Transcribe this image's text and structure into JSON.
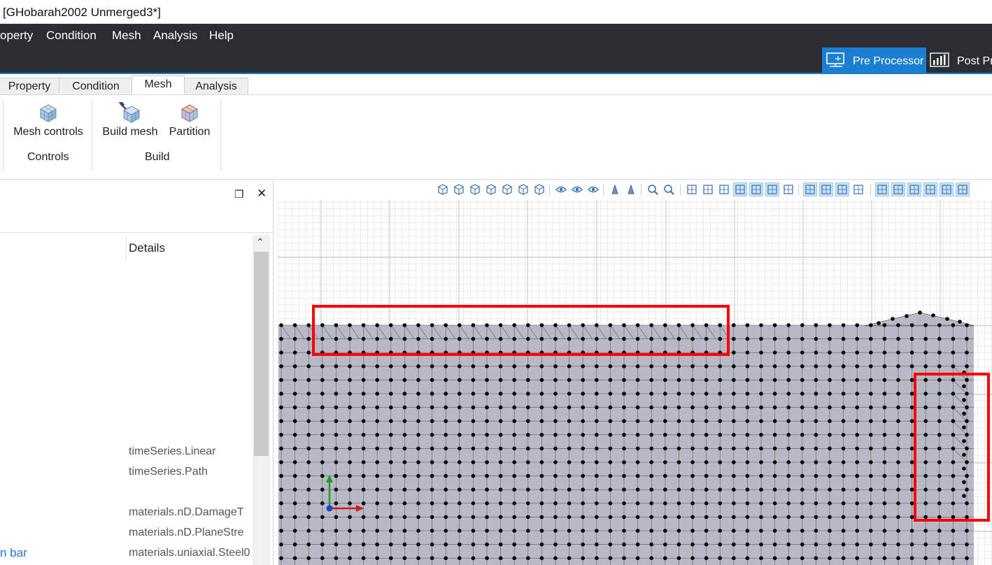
{
  "window": {
    "title": "[GHobarah2002 Unmerged3*]"
  },
  "menu": {
    "items": [
      "operty",
      "Condition",
      "Mesh",
      "Analysis",
      "Help"
    ]
  },
  "modes": {
    "pre": "Pre Processor",
    "post": "Post Pr"
  },
  "tabs": [
    "Property",
    "Condition",
    "Mesh",
    "Analysis"
  ],
  "ribbon": {
    "mesh_controls": "Mesh controls",
    "build_mesh": "Build mesh",
    "partition": "Partition",
    "group_controls": "Controls",
    "group_build": "Build"
  },
  "panel": {
    "details_header": "Details",
    "items": [
      "timeSeries.Linear",
      "timeSeries.Path",
      "materials.nD.DamageT",
      "materials.nD.PlaneStre",
      "materials.uniaxial.Steel0"
    ],
    "link": "n bar"
  },
  "viewport": {
    "toolbar_icons": [
      "view-3d-icon",
      "view-front-icon",
      "view-back-icon",
      "view-left-icon",
      "view-right-icon",
      "view-top-icon",
      "view-bottom-icon",
      "visibility-icon",
      "show-icon",
      "hide-icon",
      "perspective-icon",
      "parallel-icon",
      "zoom-fit-icon",
      "zoom-icon",
      "screenshot-icon",
      "paint-icon",
      "grid-icon",
      "grid-snap-icon",
      "axes-icon",
      "select-box-icon",
      "select-mode-icon",
      "show-nodes-icon",
      "show-edges-icon",
      "show-faces-icon",
      "show-axes-icon",
      "filter-1-icon",
      "filter-2-icon",
      "filter-3-icon",
      "filter-4-icon",
      "filter-5-icon",
      "filter-6-icon"
    ],
    "highlight_color": "#ff0000",
    "mesh_fill": "#b9b8c6",
    "x_axis_color": "#d11a1a",
    "y_axis_color": "#1f9a2e"
  },
  "colors": {
    "accent": "#1a7fd1",
    "menubar": "#2b2d33"
  }
}
